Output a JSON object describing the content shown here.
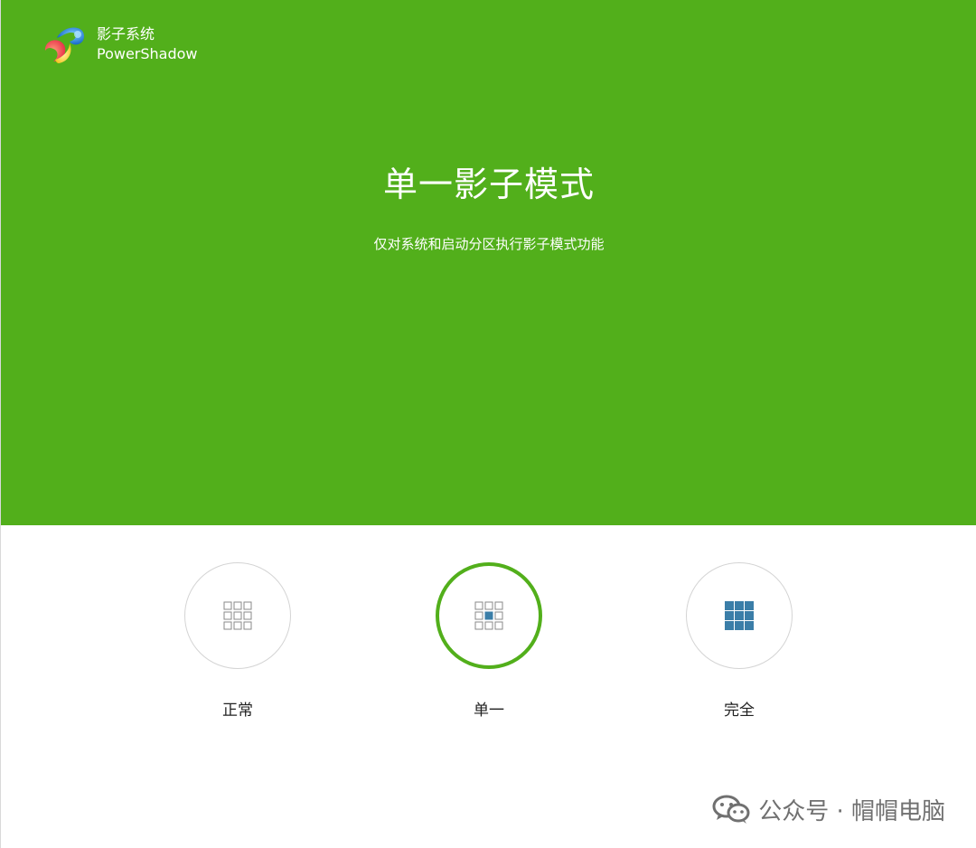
{
  "brand": {
    "name": "影子系统",
    "sub": "PowerShadow"
  },
  "hero": {
    "title": "单一影子模式",
    "subtitle": "仅对系统和启动分区执行影子模式功能",
    "color": "#52af1b"
  },
  "modes": [
    {
      "label": "正常",
      "selected": false,
      "icon": "grid-empty-icon"
    },
    {
      "label": "单一",
      "selected": true,
      "icon": "grid-center-icon"
    },
    {
      "label": "完全",
      "selected": false,
      "icon": "grid-full-icon"
    }
  ],
  "colors": {
    "accent": "#52af1b",
    "grid_fill": "#3b7ea8"
  },
  "watermark": {
    "text": "公众号 · 帽帽电脑",
    "icon": "wechat-icon"
  }
}
